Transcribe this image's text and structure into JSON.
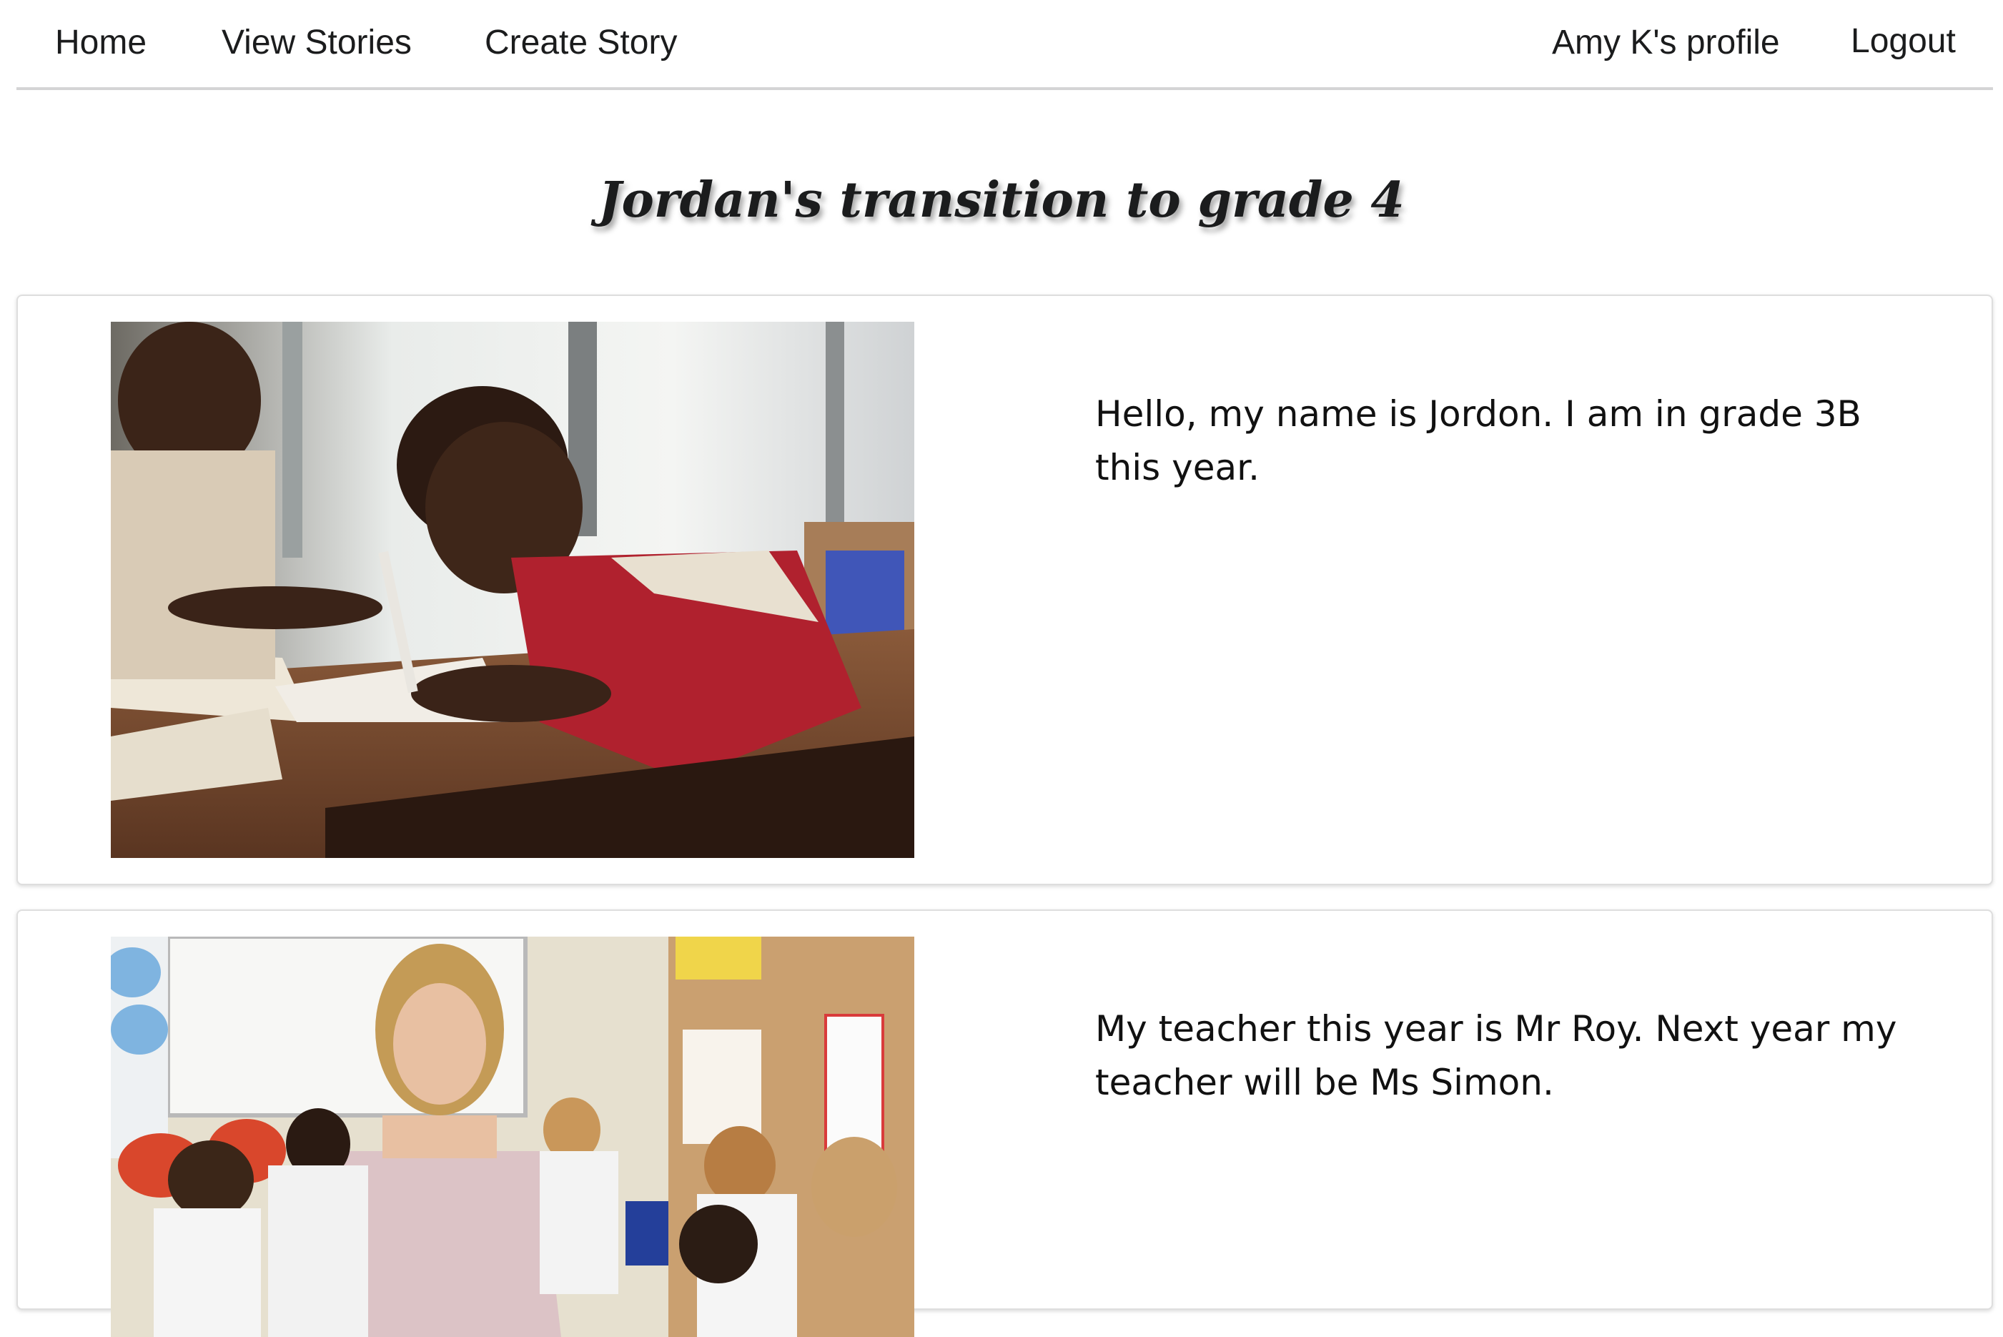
{
  "nav": {
    "home": "Home",
    "view_stories": "View Stories",
    "create_story": "Create Story",
    "profile": "Amy K's profile",
    "logout": "Logout"
  },
  "story": {
    "title": "Jordan's transition to grade 4",
    "pages": [
      {
        "photo_icon": "classroom-students-writing-photo",
        "text": "Hello, my name is Jordon. I am in grade 3B this year."
      },
      {
        "photo_icon": "teacher-in-classroom-photo",
        "text": "My teacher this year is Mr Roy. Next year my teacher will be Ms Simon."
      }
    ]
  },
  "colors": {
    "nav_border": "#d4d4d5",
    "card_border": "#dedede",
    "text": "#1b1c1d"
  }
}
